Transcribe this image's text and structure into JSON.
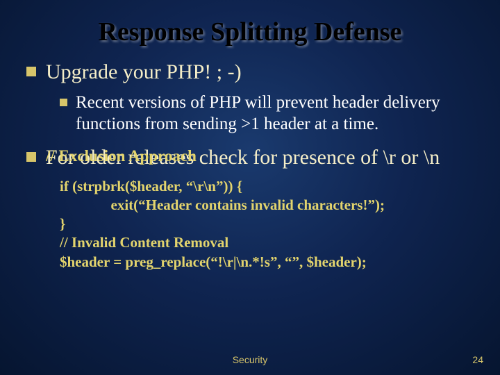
{
  "title": "Response Splitting Defense",
  "bullet1": "Upgrade your PHP! ; -)",
  "sub1": "Recent versions of PHP will prevent header delivery functions from sending >1 header at a time.",
  "bullet2": "For older releases check for presence of \\r or \\n",
  "bullet2_overlay": "// Exclusion Approach",
  "code": {
    "l1": "if (strpbrk($header, “\\r\\n”)) {",
    "l2": "              exit(“Header contains invalid characters!”);",
    "l3": "}",
    "l4": "// Invalid Content Removal",
    "l5": "$header = preg_replace(“!\\r|\\n.*!s”, “”, $header);"
  },
  "footer": {
    "center": "Security",
    "page": "24"
  }
}
